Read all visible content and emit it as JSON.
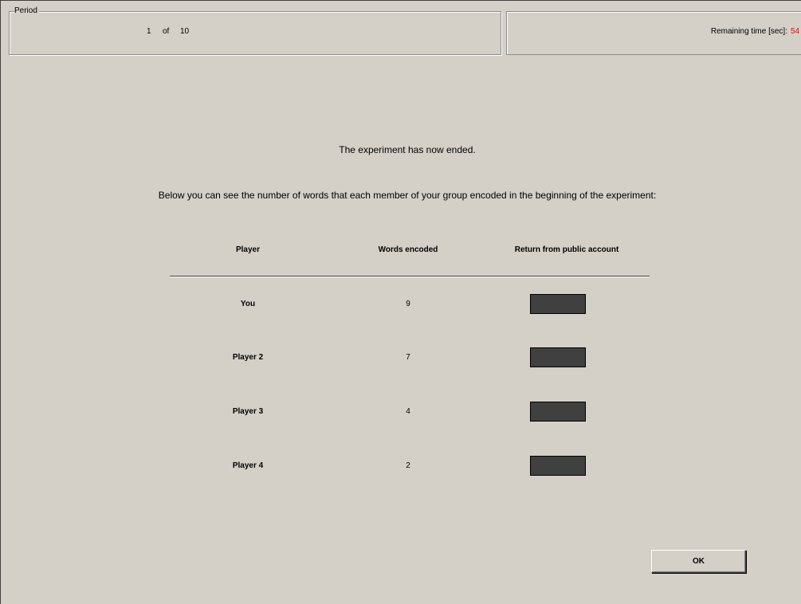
{
  "header": {
    "period_legend": "Period",
    "period_current": "1",
    "period_of": "of",
    "period_total": "10",
    "remaining_time_label": "Remaining time [sec]:",
    "remaining_time_value": "54",
    "remaining_time_color": "#ff0000"
  },
  "main": {
    "message": "The experiment has now ended.",
    "sub_message": "Below you can see the number of words that each member of your group encoded in the beginning of the experiment:"
  },
  "table": {
    "columns": [
      "Player",
      "Words encoded",
      "Return from public account"
    ],
    "rows": [
      {
        "player": "You",
        "words": "9"
      },
      {
        "player": "Player 2",
        "words": "7"
      },
      {
        "player": "Player 3",
        "words": "4"
      },
      {
        "player": "Player 4",
        "words": "2"
      }
    ]
  },
  "footer": {
    "ok_label": "OK"
  }
}
